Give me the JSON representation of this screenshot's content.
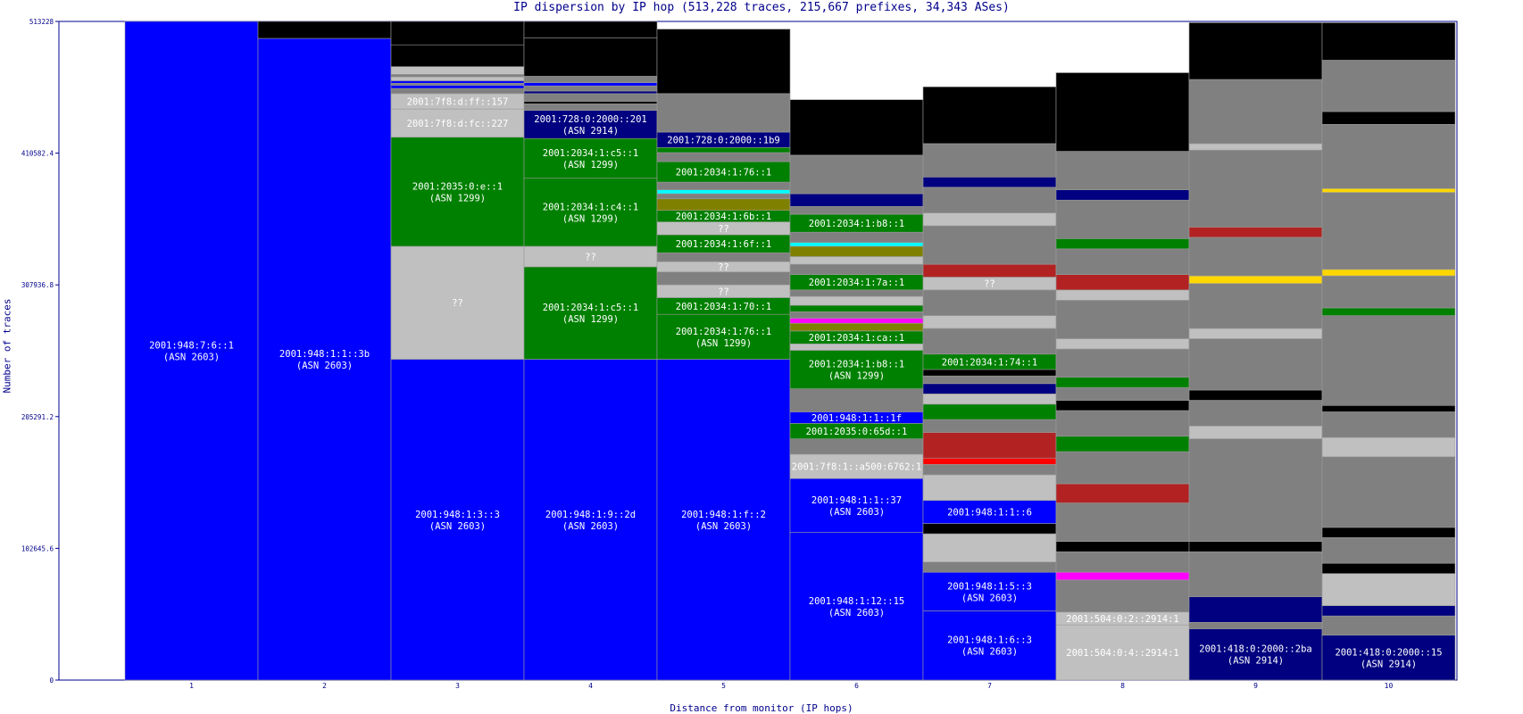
{
  "chart_data": {
    "type": "bar",
    "title": "IP dispersion by IP hop (513,228 traces, 215,667 prefixes, 34,343 ASes)",
    "xlabel": "Distance from monitor (IP hops)",
    "ylabel": "Number of traces",
    "ylim": [
      0,
      513228
    ],
    "yticks": [
      "0",
      "102645.6",
      "205291.2",
      "307936.8",
      "410582.4",
      "513228"
    ],
    "categories": [
      "1",
      "2",
      "3",
      "4",
      "5",
      "6",
      "7",
      "8",
      "9",
      "10"
    ],
    "colors": {
      "blue": "#0000ff",
      "navy": "#000080",
      "green": "#008000",
      "lightgray": "#c0c0c0",
      "gray": "#808080",
      "black": "#000000",
      "olive": "#808000",
      "cyan": "#00ffff",
      "red": "#ff0000",
      "darkred": "#b22222",
      "magenta": "#ff00ff",
      "yellow": "#ffd700"
    },
    "hops": [
      {
        "hop": "1",
        "segments": [
          {
            "value": 513228,
            "color": "#0000ff",
            "label": [
              "2001:948:7:6::1",
              "(ASN 2603)"
            ]
          }
        ]
      },
      {
        "hop": "2",
        "segments": [
          {
            "value": 500000,
            "color": "#0000ff",
            "label": [
              "2001:948:1:1::3b",
              "(ASN 2603)"
            ]
          },
          {
            "value": 13228,
            "color": "#000000"
          }
        ]
      },
      {
        "hop": "3",
        "segments": [
          {
            "value": 250000,
            "color": "#0000ff",
            "label": [
              "2001:948:1:3::3",
              "(ASN 2603)"
            ]
          },
          {
            "value": 88000,
            "color": "#c0c0c0",
            "label": [
              "??"
            ]
          },
          {
            "value": 85000,
            "color": "#008000",
            "label": [
              "2001:2035:0:e::1",
              "(ASN 1299)"
            ]
          },
          {
            "value": 22000,
            "color": "#c0c0c0",
            "label": [
              "2001:7f8:d:fc::227"
            ]
          },
          {
            "value": 12000,
            "color": "#c0c0c0",
            "label": [
              "2001:7f8:d:ff::157"
            ]
          },
          {
            "value": 4000,
            "color": "#808080"
          },
          {
            "value": 2500,
            "color": "#0000ff"
          },
          {
            "value": 1500,
            "color": "#808080"
          },
          {
            "value": 2000,
            "color": "#0000ff"
          },
          {
            "value": 3000,
            "color": "#c0c0c0"
          },
          {
            "value": 2000,
            "color": "#808080"
          },
          {
            "value": 6000,
            "color": "#c0c0c0"
          },
          {
            "value": 17000,
            "color": "#000000"
          },
          {
            "value": 18228,
            "color": "#000000"
          }
        ]
      },
      {
        "hop": "4",
        "segments": [
          {
            "value": 250000,
            "color": "#0000ff",
            "label": [
              "2001:948:1:9::2d",
              "(ASN 2603)"
            ]
          },
          {
            "value": 72000,
            "color": "#008000",
            "label": [
              "2001:2034:1:c5::1",
              "(ASN 1299)"
            ]
          },
          {
            "value": 16000,
            "color": "#c0c0c0",
            "label": [
              "??"
            ]
          },
          {
            "value": 53000,
            "color": "#008000",
            "label": [
              "2001:2034:1:c4::1",
              "(ASN 1299)"
            ]
          },
          {
            "value": 31000,
            "color": "#008000",
            "label": [
              "2001:2034:1:c5::1",
              "(ASN 1299)"
            ]
          },
          {
            "value": 22000,
            "color": "#000080",
            "label": [
              "2001:728:0:2000::201",
              "(ASN 2914)"
            ]
          },
          {
            "value": 5000,
            "color": "#808080"
          },
          {
            "value": 2000,
            "color": "#000000"
          },
          {
            "value": 6000,
            "color": "#808080"
          },
          {
            "value": 2000,
            "color": "#000080"
          },
          {
            "value": 4000,
            "color": "#808080"
          },
          {
            "value": 2500,
            "color": "#0000ff"
          },
          {
            "value": 5000,
            "color": "#808080"
          },
          {
            "value": 30000,
            "color": "#000000"
          },
          {
            "value": 12728,
            "color": "#000000"
          }
        ]
      },
      {
        "hop": "5",
        "segments": [
          {
            "value": 250000,
            "color": "#0000ff",
            "label": [
              "2001:948:1:f::2",
              "(ASN 2603)"
            ]
          },
          {
            "value": 35000,
            "color": "#008000",
            "label": [
              "2001:2034:1:76::1",
              "(ASN 1299)"
            ]
          },
          {
            "value": 13000,
            "color": "#008000",
            "label": [
              "2001:2034:1:70::1"
            ]
          },
          {
            "value": 10000,
            "color": "#c0c0c0",
            "label": [
              "??"
            ]
          },
          {
            "value": 10000,
            "color": "#808080"
          },
          {
            "value": 8000,
            "color": "#c0c0c0",
            "label": [
              "??"
            ]
          },
          {
            "value": 7000,
            "color": "#808080"
          },
          {
            "value": 14000,
            "color": "#008000",
            "label": [
              "2001:2034:1:6f::1"
            ]
          },
          {
            "value": 10000,
            "color": "#c0c0c0",
            "label": [
              "??"
            ]
          },
          {
            "value": 9000,
            "color": "#008000",
            "label": [
              "2001:2034:1:6b::1"
            ]
          },
          {
            "value": 9000,
            "color": "#808000"
          },
          {
            "value": 4000,
            "color": "#808080"
          },
          {
            "value": 3000,
            "color": "#00ffff"
          },
          {
            "value": 6000,
            "color": "#808080"
          },
          {
            "value": 16000,
            "color": "#008000",
            "label": [
              "2001:2034:1:76::1"
            ]
          },
          {
            "value": 7000,
            "color": "#808080"
          },
          {
            "value": 4000,
            "color": "#008000"
          },
          {
            "value": 12000,
            "color": "#000080",
            "label": [
              "2001:728:0:2000::1b9"
            ]
          },
          {
            "value": 30000,
            "color": "#808080"
          },
          {
            "value": 50228,
            "color": "#000000"
          }
        ]
      },
      {
        "hop": "6",
        "segments": [
          {
            "value": 115000,
            "color": "#0000ff",
            "label": [
              "2001:948:1:12::15",
              "(ASN 2603)"
            ]
          },
          {
            "value": 42000,
            "color": "#0000ff",
            "label": [
              "2001:948:1:1::37",
              "(ASN 2603)"
            ]
          },
          {
            "value": 19000,
            "color": "#c0c0c0",
            "label": [
              "2001:7f8:1::a500:6762:1"
            ]
          },
          {
            "value": 12000,
            "color": "#808080"
          },
          {
            "value": 12000,
            "color": "#008000",
            "label": [
              "2001:2035:0:65d::1"
            ]
          },
          {
            "value": 9000,
            "color": "#0000ff",
            "label": [
              "2001:948:1:1::1f"
            ]
          },
          {
            "value": 18000,
            "color": "#808080"
          },
          {
            "value": 30000,
            "color": "#008000",
            "label": [
              "2001:2034:1:b8::1",
              "(ASN 1299)"
            ]
          },
          {
            "value": 5000,
            "color": "#c0c0c0"
          },
          {
            "value": 10000,
            "color": "#008000",
            "label": [
              "2001:2034:1:ca::1"
            ]
          },
          {
            "value": 6000,
            "color": "#808000"
          },
          {
            "value": 4000,
            "color": "#ff00ff"
          },
          {
            "value": 5000,
            "color": "#808080"
          },
          {
            "value": 5000,
            "color": "#008000"
          },
          {
            "value": 7000,
            "color": "#c0c0c0"
          },
          {
            "value": 5000,
            "color": "#808080"
          },
          {
            "value": 12000,
            "color": "#008000",
            "label": [
              "2001:2034:1:7a::1"
            ]
          },
          {
            "value": 8000,
            "color": "#808080"
          },
          {
            "value": 6000,
            "color": "#c0c0c0"
          },
          {
            "value": 8000,
            "color": "#808000"
          },
          {
            "value": 3000,
            "color": "#00ffff"
          },
          {
            "value": 8000,
            "color": "#808080"
          },
          {
            "value": 14000,
            "color": "#008000",
            "label": [
              "2001:2034:1:b8::1"
            ]
          },
          {
            "value": 6000,
            "color": "#808080"
          },
          {
            "value": 10000,
            "color": "#000080"
          },
          {
            "value": 30000,
            "color": "#808080"
          },
          {
            "value": 43228,
            "color": "#000000"
          }
        ]
      },
      {
        "hop": "7",
        "segments": [
          {
            "value": 54000,
            "color": "#0000ff",
            "label": [
              "2001:948:1:6::3",
              "(ASN 2603)"
            ]
          },
          {
            "value": 30000,
            "color": "#0000ff",
            "label": [
              "2001:948:1:5::3",
              "(ASN 2603)"
            ]
          },
          {
            "value": 8000,
            "color": "#808080"
          },
          {
            "value": 22000,
            "color": "#c0c0c0"
          },
          {
            "value": 8000,
            "color": "#000000"
          },
          {
            "value": 18000,
            "color": "#0000ff",
            "label": [
              "2001:948:1:1::6"
            ]
          },
          {
            "value": 20000,
            "color": "#c0c0c0"
          },
          {
            "value": 8000,
            "color": "#808080"
          },
          {
            "value": 5000,
            "color": "#ff0000"
          },
          {
            "value": 20000,
            "color": "#b22222"
          },
          {
            "value": 10000,
            "color": "#808080"
          },
          {
            "value": 12000,
            "color": "#008000"
          },
          {
            "value": 8000,
            "color": "#c0c0c0"
          },
          {
            "value": 8000,
            "color": "#000080"
          },
          {
            "value": 6000,
            "color": "#808080"
          },
          {
            "value": 5000,
            "color": "#000000"
          },
          {
            "value": 12000,
            "color": "#008000",
            "label": [
              "2001:2034:1:74::1"
            ]
          },
          {
            "value": 20000,
            "color": "#808080"
          },
          {
            "value": 10000,
            "color": "#c0c0c0"
          },
          {
            "value": 20000,
            "color": "#808080"
          },
          {
            "value": 10000,
            "color": "#c0c0c0",
            "label": [
              "??"
            ]
          },
          {
            "value": 10000,
            "color": "#b22222"
          },
          {
            "value": 30000,
            "color": "#808080"
          },
          {
            "value": 10000,
            "color": "#c0c0c0"
          },
          {
            "value": 20000,
            "color": "#808080"
          },
          {
            "value": 8000,
            "color": "#000080"
          },
          {
            "value": 26000,
            "color": "#808080"
          },
          {
            "value": 44228,
            "color": "#000000"
          }
        ]
      },
      {
        "hop": "8",
        "segments": [
          {
            "value": 43000,
            "color": "#c0c0c0",
            "label": [
              "2001:504:0:4::2914:1"
            ]
          },
          {
            "value": 10000,
            "color": "#c0c0c0",
            "label": [
              "2001:504:0:2::2914:1"
            ]
          },
          {
            "value": 25000,
            "color": "#808080"
          },
          {
            "value": 6000,
            "color": "#ff00ff"
          },
          {
            "value": 16000,
            "color": "#808080"
          },
          {
            "value": 8000,
            "color": "#000000"
          },
          {
            "value": 30000,
            "color": "#808080"
          },
          {
            "value": 15000,
            "color": "#b22222"
          },
          {
            "value": 25000,
            "color": "#808080"
          },
          {
            "value": 12000,
            "color": "#008000"
          },
          {
            "value": 20000,
            "color": "#808080"
          },
          {
            "value": 8000,
            "color": "#000000"
          },
          {
            "value": 10000,
            "color": "#808080"
          },
          {
            "value": 8000,
            "color": "#008000"
          },
          {
            "value": 22000,
            "color": "#808080"
          },
          {
            "value": 8000,
            "color": "#c0c0c0"
          },
          {
            "value": 30000,
            "color": "#808080"
          },
          {
            "value": 8000,
            "color": "#c0c0c0"
          },
          {
            "value": 12000,
            "color": "#b22222"
          },
          {
            "value": 20000,
            "color": "#808080"
          },
          {
            "value": 8000,
            "color": "#008000"
          },
          {
            "value": 30000,
            "color": "#808080"
          },
          {
            "value": 8000,
            "color": "#000080"
          },
          {
            "value": 30000,
            "color": "#808080"
          },
          {
            "value": 61228,
            "color": "#000000"
          }
        ]
      },
      {
        "hop": "9",
        "segments": [
          {
            "value": 40000,
            "color": "#000080",
            "label": [
              "2001:418:0:2000::2ba",
              "(ASN 2914)"
            ]
          },
          {
            "value": 5000,
            "color": "#808080"
          },
          {
            "value": 20000,
            "color": "#000080"
          },
          {
            "value": 35000,
            "color": "#808080"
          },
          {
            "value": 8000,
            "color": "#000000"
          },
          {
            "value": 80000,
            "color": "#808080"
          },
          {
            "value": 10000,
            "color": "#c0c0c0"
          },
          {
            "value": 20000,
            "color": "#808080"
          },
          {
            "value": 8000,
            "color": "#000000"
          },
          {
            "value": 40000,
            "color": "#808080"
          },
          {
            "value": 8000,
            "color": "#c0c0c0"
          },
          {
            "value": 35000,
            "color": "#808080"
          },
          {
            "value": 6000,
            "color": "#ffd700"
          },
          {
            "value": 30000,
            "color": "#808080"
          },
          {
            "value": 8000,
            "color": "#b22222"
          },
          {
            "value": 60000,
            "color": "#808080"
          },
          {
            "value": 5000,
            "color": "#c0c0c0"
          },
          {
            "value": 50000,
            "color": "#808080"
          },
          {
            "value": 44228,
            "color": "#000000"
          }
        ]
      },
      {
        "hop": "10",
        "segments": [
          {
            "value": 35000,
            "color": "#000080",
            "label": [
              "2001:418:0:2000::15",
              "(ASN 2914)"
            ]
          },
          {
            "value": 15000,
            "color": "#808080"
          },
          {
            "value": 8000,
            "color": "#000080"
          },
          {
            "value": 25000,
            "color": "#c0c0c0"
          },
          {
            "value": 8000,
            "color": "#000000"
          },
          {
            "value": 20000,
            "color": "#808080"
          },
          {
            "value": 8000,
            "color": "#000000"
          },
          {
            "value": 55000,
            "color": "#808080"
          },
          {
            "value": 15000,
            "color": "#c0c0c0"
          },
          {
            "value": 20000,
            "color": "#808080"
          },
          {
            "value": 5000,
            "color": "#000000"
          },
          {
            "value": 70000,
            "color": "#808080"
          },
          {
            "value": 6000,
            "color": "#008000"
          },
          {
            "value": 25000,
            "color": "#808080"
          },
          {
            "value": 5000,
            "color": "#ffd700"
          },
          {
            "value": 60000,
            "color": "#808080"
          },
          {
            "value": 3000,
            "color": "#ffd700"
          },
          {
            "value": 50000,
            "color": "#808080"
          },
          {
            "value": 10000,
            "color": "#000000"
          },
          {
            "value": 40000,
            "color": "#808080"
          },
          {
            "value": 29228,
            "color": "#000000"
          }
        ]
      }
    ]
  }
}
